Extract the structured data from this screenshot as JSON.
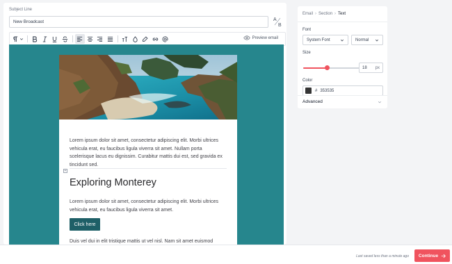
{
  "subject": {
    "label": "Subject Line",
    "value": "New Broadcast"
  },
  "toolbar": {
    "preview_label": "Preview email",
    "icons": [
      "paragraph-icon",
      "bold-icon",
      "italic-icon",
      "underline-icon",
      "strikethrough-icon",
      "align-left-icon",
      "align-center-icon",
      "align-right-icon",
      "align-justify-icon",
      "text-size-icon",
      "text-color-icon",
      "highlight-icon",
      "link-icon",
      "mention-icon"
    ]
  },
  "email": {
    "paragraph_1": "Lorem ipsum dolor sit amet, consectetur adipiscing elit. Morbi ultrices vehicula erat, eu faucibus ligula viverra sit amet. Nullam porta scelerisque lacus eu dignissim. Curabitur mattis dui est, sed gravida ex tincidunt sed.",
    "heading": "Exploring Monterey",
    "paragraph_2": "Lorem ipsum dolor sit amet, consectetur adipiscing elit. Morbi ultrices vehicula erat, eu faucibus ligula viverra sit amet.",
    "button_label": "Click here",
    "paragraph_3": "Duis vel dui in elit tristique mattis ut vel nisl. Nam sit amet euismod"
  },
  "panel": {
    "breadcrumb": [
      "Email",
      "Section",
      "Text"
    ],
    "font_label": "Font",
    "font_family": "System Font",
    "font_weight": "Normal",
    "size_label": "Size",
    "size_value": "18",
    "size_unit": "px",
    "size_fill_fraction": 0.35,
    "color_label": "Color",
    "color_hash": "#",
    "color_value": "353535",
    "advanced_label": "Advanced"
  },
  "footer": {
    "saved_text": "Last saved less than a minute ago",
    "continue_label": "Continue"
  },
  "colors": {
    "canvas_bg": "#26868d",
    "button_bg": "#1e5f67",
    "accent": "#f0535e",
    "text_color": "#353535"
  }
}
